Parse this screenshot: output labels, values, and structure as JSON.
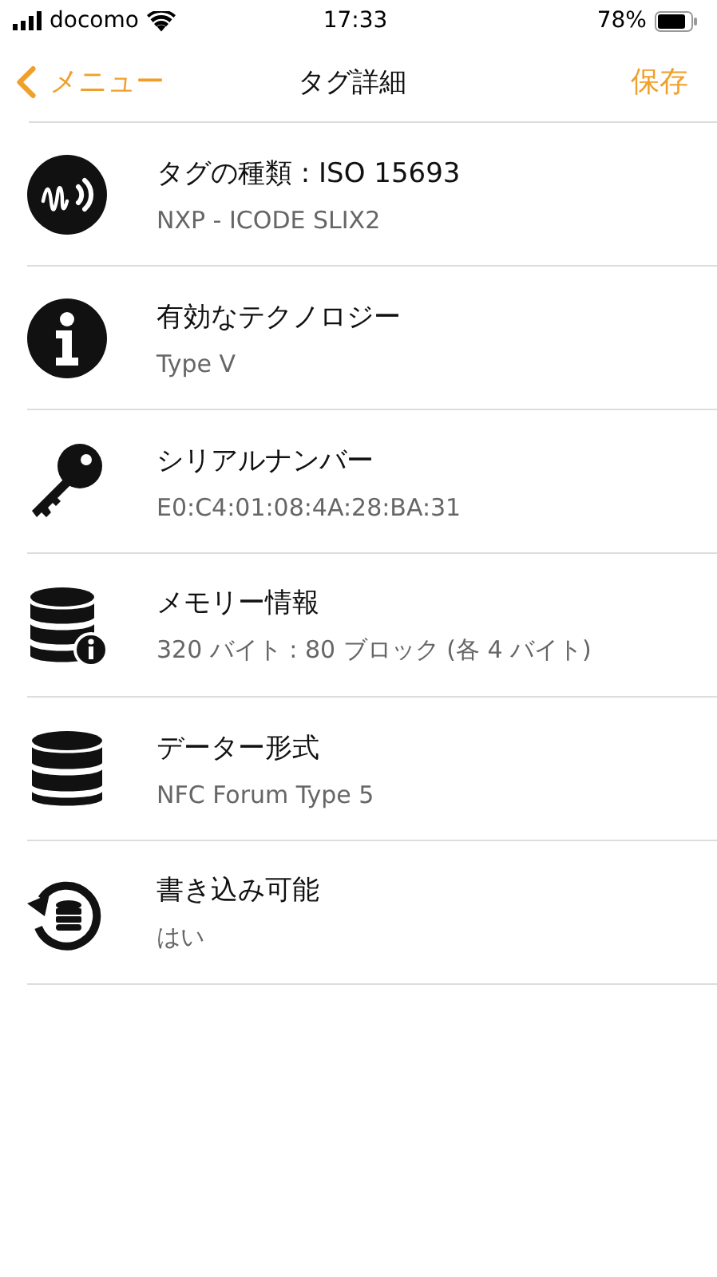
{
  "status_bar": {
    "carrier": "docomo",
    "time": "17:33",
    "battery": "78%"
  },
  "nav": {
    "back": "メニュー",
    "title": "タグ詳細",
    "action": "保存"
  },
  "rows": [
    {
      "kind": "tag",
      "title": "タグの種類 : ISO 15693",
      "value": "NXP - ICODE SLIX2"
    },
    {
      "kind": "info",
      "title": "有効なテクノロジー",
      "value": "Type V"
    },
    {
      "kind": "key",
      "title": "シリアルナンバー",
      "value": "E0:C4:01:08:4A:28:BA:31"
    },
    {
      "kind": "memory",
      "title": "メモリー情報",
      "value": "320 バイト : 80 ブロック (各 4 バイト)"
    },
    {
      "kind": "format",
      "title": "データー形式",
      "value": "NFC Forum Type 5"
    },
    {
      "kind": "writable",
      "title": "書き込み可能",
      "value": "はい"
    }
  ]
}
